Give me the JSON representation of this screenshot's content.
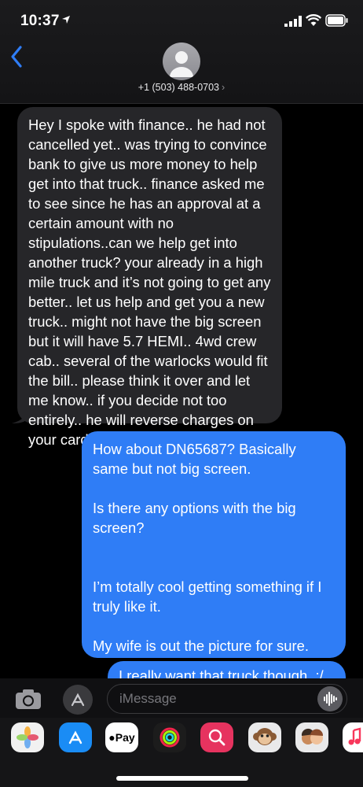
{
  "status_bar": {
    "time": "10:37"
  },
  "header": {
    "contact": "+1 (503) 488-0703",
    "chevron": "›"
  },
  "messages": {
    "received": "Hey I spoke with finance.. he had not cancelled yet.. was trying to convince bank to give us more money to help get into that truck.. finance asked me to see since he has an approval at a certain amount with no stipulations..can we help get into another truck? your already in a high mile truck and it’s not going to get any better.. let us help and get you a new truck.. might not have the big screen but it will have 5.7 HEMI.. 4wd crew cab.. several of the warlocks would fit the bill.. please think it over and let me know.. if you decide not too entirely.. he will reverse charges on your card",
    "sent": "How about DN65687? Basically same but not big screen.\n\nIs there any options with the big screen?\n\n\nI’m totally cool getting something if I truly like it.\n\nMy wife is out the picture for sure.",
    "sent_partial": "I really want that truck though. :/"
  },
  "input": {
    "placeholder": "iMessage"
  },
  "app_drawer": {
    "apple_pay_label": "Pay"
  },
  "colors": {
    "sent_bubble": "#2f7df6",
    "received_bubble": "#262629",
    "accent": "#1a8cf5"
  },
  "icons": [
    "location-arrow-icon",
    "signal-icon",
    "wifi-icon",
    "battery-icon",
    "back-chevron-icon",
    "person-icon",
    "camera-icon",
    "app-store-icon",
    "audio-waveform-icon",
    "photos-icon",
    "apple-pay-icon",
    "activity-rings-icon",
    "image-search-icon",
    "monkey-animoji-icon",
    "memoji-icon",
    "music-icon"
  ]
}
